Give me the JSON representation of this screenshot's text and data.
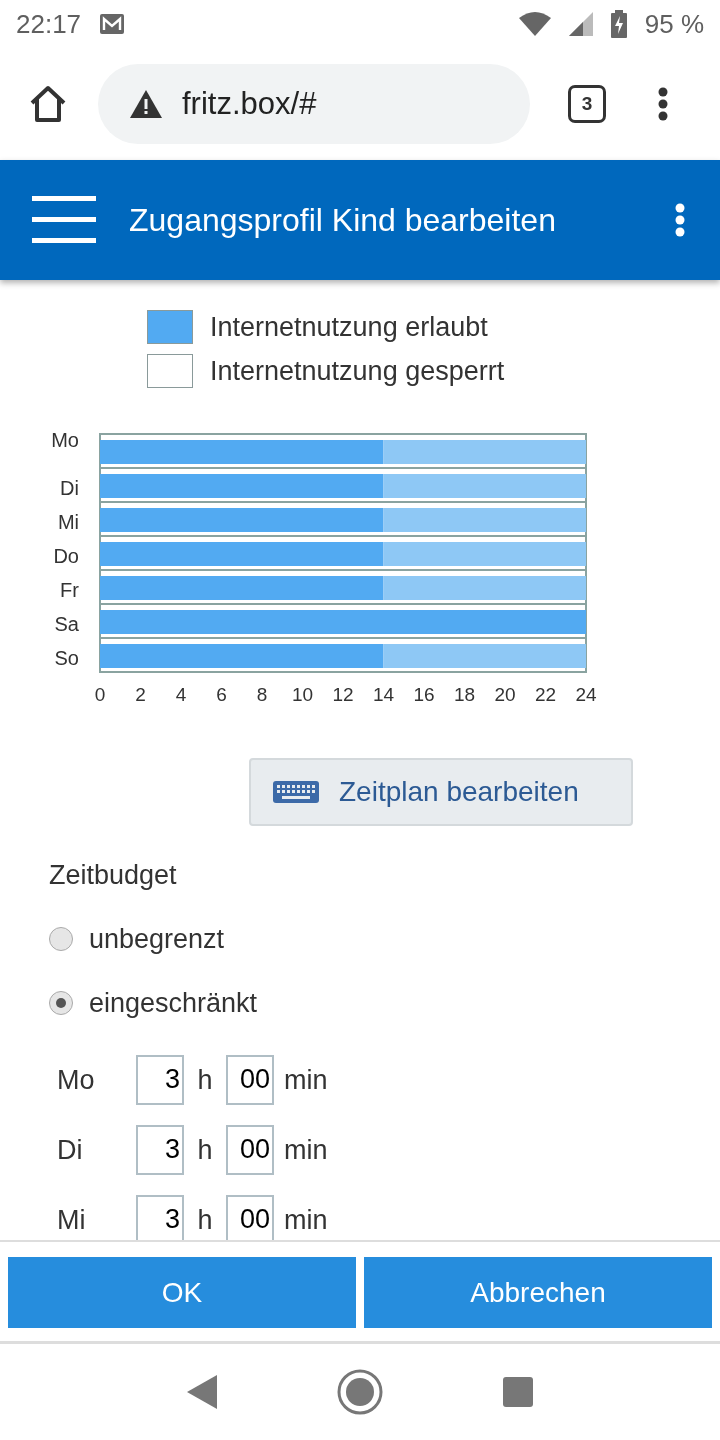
{
  "status_bar": {
    "time": "22:17",
    "battery": "95 %"
  },
  "browser": {
    "url": "fritz.box/#",
    "tab_count": "3"
  },
  "header": {
    "title": "Zugangsprofil Kind bearbeiten"
  },
  "legend": [
    {
      "label": "Internetnutzung erlaubt",
      "color": "#52aaf2"
    },
    {
      "label": "Internetnutzung gesperrt",
      "color": "#ffffff"
    }
  ],
  "schedule": {
    "chart_data": {
      "type": "bar",
      "orientation": "horizontal",
      "stacked": true,
      "categories": [
        "Mo",
        "Di",
        "Mi",
        "Do",
        "Fr",
        "Sa",
        "So"
      ],
      "xlim": [
        0,
        24
      ],
      "xticks": [
        0,
        2,
        4,
        6,
        8,
        10,
        12,
        14,
        16,
        18,
        20,
        22,
        24
      ],
      "series": [
        {
          "color": "#52aaf2",
          "values": [
            14,
            14,
            14,
            14,
            14,
            24,
            14
          ]
        },
        {
          "color": "#8ec8f5",
          "values": [
            10,
            10,
            10,
            10,
            10,
            0,
            10
          ]
        }
      ]
    }
  },
  "edit_button": {
    "label": "Zeitplan bearbeiten"
  },
  "budget": {
    "title": "Zeitbudget",
    "options": [
      {
        "label": "unbegrenzt",
        "selected": false
      },
      {
        "label": "eingeschränkt",
        "selected": true
      }
    ],
    "days": [
      {
        "day": "Mo",
        "hours": "3",
        "hours_unit": "h",
        "minutes": "00",
        "minutes_unit": "min"
      },
      {
        "day": "Di",
        "hours": "3",
        "hours_unit": "h",
        "minutes": "00",
        "minutes_unit": "min"
      },
      {
        "day": "Mi",
        "hours": "3",
        "hours_unit": "h",
        "minutes": "00",
        "minutes_unit": "min"
      }
    ]
  },
  "buttons": [
    {
      "label": "OK"
    },
    {
      "label": "Abbrechen"
    }
  ]
}
